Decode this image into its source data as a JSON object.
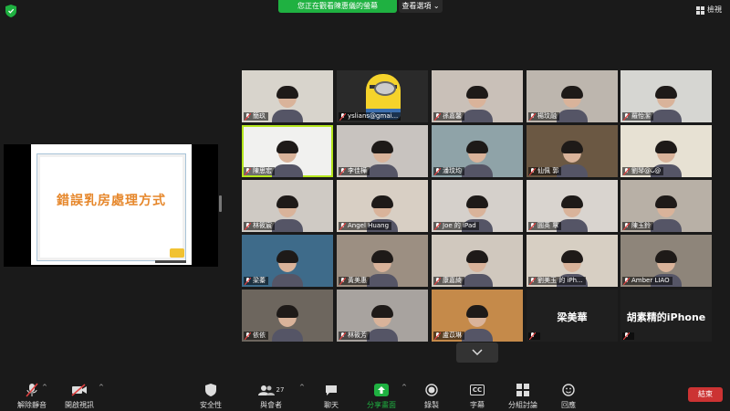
{
  "top": {
    "share_banner": "您正在觀看陳惠儀的螢幕",
    "view_options": "查看選項",
    "view_label": "檢視"
  },
  "slide": {
    "title": "錯誤乳房處理方式"
  },
  "participants": [
    {
      "name": "簡玖",
      "bg": "#d8d4cc",
      "active": false
    },
    {
      "name": "yslians@gmai...",
      "bg": "#2a2a2a",
      "active": false,
      "avatar": "minion"
    },
    {
      "name": "孫嘉馨",
      "bg": "#c9c0b8",
      "active": false
    },
    {
      "name": "楊玟融",
      "bg": "#bdb6ae",
      "active": false
    },
    {
      "name": "羅怡潔",
      "bg": "#d6d6d2",
      "active": false
    },
    {
      "name": "陳思宏",
      "bg": "#f1f1ef",
      "active": true
    },
    {
      "name": "李佳樺",
      "bg": "#c8c3bf",
      "active": false
    },
    {
      "name": "潘玟均",
      "bg": "#8fa3a8",
      "active": false
    },
    {
      "name": "仙佩 郭",
      "bg": "#6b5843",
      "active": false
    },
    {
      "name": "劉琴@ᴗ@",
      "bg": "#e7e1d3",
      "active": false
    },
    {
      "name": "林筱宸",
      "bg": "#cfcac4",
      "active": false
    },
    {
      "name": "Angel Huang",
      "bg": "#d8cfc4",
      "active": false
    },
    {
      "name": "Joe 的 iPad",
      "bg": "#d5d0cb",
      "active": false
    },
    {
      "name": "圓英 覃",
      "bg": "#d9d4cf",
      "active": false
    },
    {
      "name": "陳玉鈴",
      "bg": "#b8b0a6",
      "active": false
    },
    {
      "name": "梁蓁",
      "bg": "#3e6b8a",
      "active": false
    },
    {
      "name": "黃美惠",
      "bg": "#9c8f82",
      "active": false
    },
    {
      "name": "康嘉綺",
      "bg": "#d0c8be",
      "active": false
    },
    {
      "name": "劉美玉 的 iPh...",
      "bg": "#d7cfc3",
      "active": false
    },
    {
      "name": "Amber LIAO",
      "bg": "#8e857a",
      "active": false
    },
    {
      "name": "依依",
      "bg": "#6d665e",
      "active": false
    },
    {
      "name": "林筱芳",
      "bg": "#a8a39f",
      "active": false
    },
    {
      "name": "盧苡琳",
      "bg": "#c58a4a",
      "active": false
    },
    {
      "name": "",
      "bg": "#1f1f1f",
      "active": false,
      "bigname": "梁美華"
    },
    {
      "name": "",
      "bg": "#1f1f1f",
      "active": false,
      "bigname": "胡素精的iPhone"
    }
  ],
  "toolbar": {
    "unmute": "解除靜音",
    "start_video": "開啟視訊",
    "security": "安全性",
    "participants": "與會者",
    "participants_count": "27",
    "chat": "聊天",
    "share_screen": "分享畫面",
    "record": "錄製",
    "captions": "字幕",
    "breakout": "分組討論",
    "reactions": "回應",
    "end": "結束",
    "cc": "CC"
  },
  "colors": {
    "share_green": "#1fb141",
    "active_border": "#b5e61d",
    "end_red": "#cc3333",
    "slide_title": "#e6872b"
  }
}
